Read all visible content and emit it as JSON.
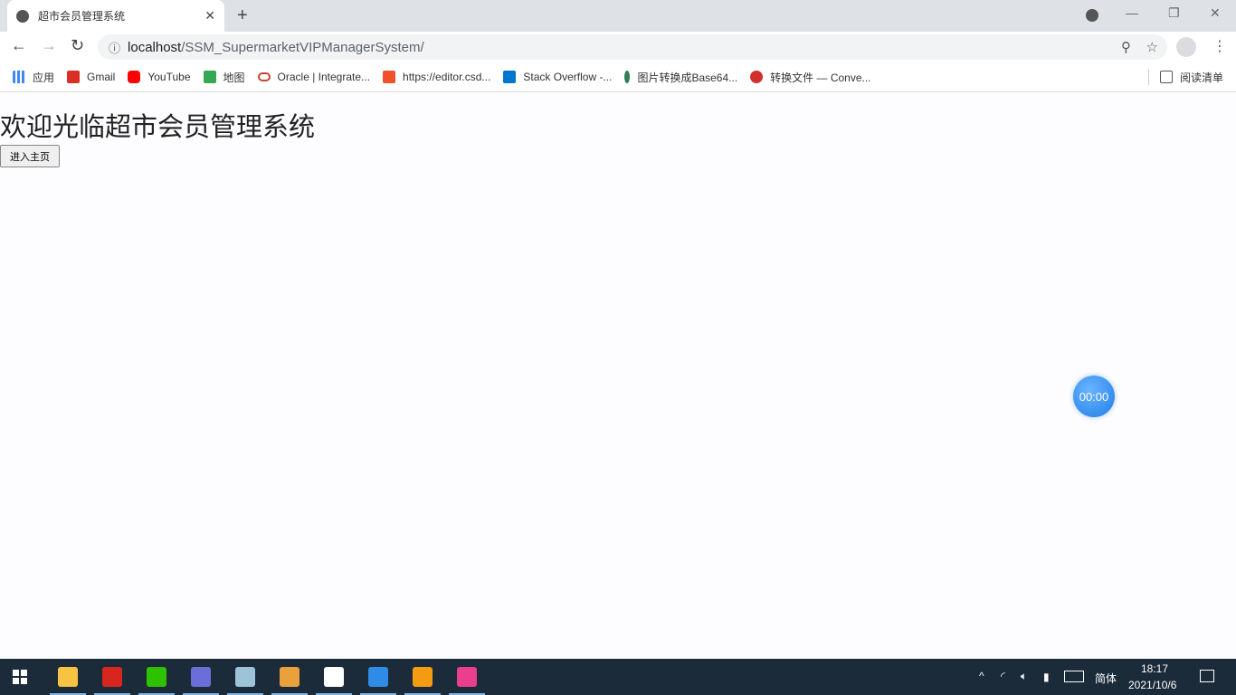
{
  "browser": {
    "tab_title": "超市会员管理系统",
    "url_host": "localhost",
    "url_path": "/SSM_SupermarketVIPManagerSystem/",
    "bookmarks": [
      {
        "label": "应用",
        "color": "#e8453c"
      },
      {
        "label": "Gmail",
        "color": "#d93025"
      },
      {
        "label": "YouTube",
        "color": "#ff0000"
      },
      {
        "label": "地图",
        "color": "#34a853"
      },
      {
        "label": "Oracle | Integrate...",
        "color": "#c74634"
      },
      {
        "label": "https://editor.csd...",
        "color": "#f0512b"
      },
      {
        "label": "Stack Overflow -...",
        "color": "#0077cc"
      },
      {
        "label": "图片转换成Base64...",
        "color": "#2e7d5b"
      },
      {
        "label": "转换文件 — Conve...",
        "color": "#d32f2f"
      }
    ],
    "reading_list": "阅读清单"
  },
  "page": {
    "heading": "欢迎光临超市会员管理系统",
    "enter_button": "进入主页",
    "timer": "00:00"
  },
  "taskbar": {
    "apps": [
      {
        "name": "file-explorer",
        "color": "#f6c343"
      },
      {
        "name": "wps",
        "color": "#d7261e"
      },
      {
        "name": "wechat",
        "color": "#2dc100"
      },
      {
        "name": "app-dolphin",
        "color": "#6a6fd8"
      },
      {
        "name": "app-notes",
        "color": "#9cc3d6"
      },
      {
        "name": "chrome",
        "color": "#e9a23b"
      },
      {
        "name": "typora",
        "color": "#ffffff"
      },
      {
        "name": "media-player",
        "color": "#2e8ce6"
      },
      {
        "name": "sublime-text",
        "color": "#f39c12"
      },
      {
        "name": "intellij-idea",
        "color": "#e93f8e"
      }
    ],
    "ime": "简体",
    "time": "18:17",
    "date": "2021/10/6"
  }
}
